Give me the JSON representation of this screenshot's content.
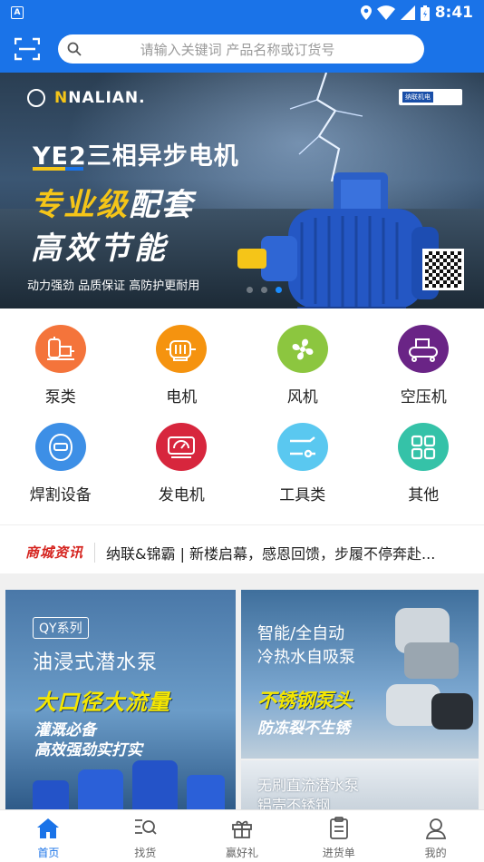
{
  "status_bar": {
    "time": "8:41",
    "app_indicator": "A"
  },
  "search": {
    "placeholder": "请输入关键词 产品名称或订货号"
  },
  "banner": {
    "brand": "NALIAN.",
    "badge": "纳联机电",
    "title": "YE2三相异步电机",
    "slogan_highlight": "专业级",
    "slogan_rest": "配套",
    "slogan2": "高效节能",
    "tagline": "动力强劲 品质保证 高防护更耐用",
    "slide_count": 3,
    "active_slide": 2
  },
  "categories": [
    {
      "label": "泵类",
      "icon": "pump-icon",
      "color": "#f4743b"
    },
    {
      "label": "电机",
      "icon": "motor-icon",
      "color": "#f5930f"
    },
    {
      "label": "风机",
      "icon": "fan-icon",
      "color": "#8cc63f"
    },
    {
      "label": "空压机",
      "icon": "air-compressor-icon",
      "color": "#6a2486"
    },
    {
      "label": "焊割设备",
      "icon": "welding-mask-icon",
      "color": "#3d8fe6"
    },
    {
      "label": "发电机",
      "icon": "generator-icon",
      "color": "#d7263d"
    },
    {
      "label": "工具类",
      "icon": "tools-icon",
      "color": "#5ac8f0"
    },
    {
      "label": "其他",
      "icon": "grid-icon",
      "color": "#35c2a8"
    }
  ],
  "news": {
    "tag": "商城资讯",
    "headline": "纳联&锦霸 | 新楼启幕，感恩回馈，步履不停奔赴..."
  },
  "promos": {
    "left": {
      "badge": "QY系列",
      "title": "油浸式潜水泵",
      "highlight": "大口径大流量",
      "sub1": "灌溉必备",
      "sub2": "高效强劲实打实"
    },
    "right_top": {
      "title1": "智能/全自动",
      "title2": "冷热水自吸泵",
      "highlight": "不锈钢泵头",
      "sub": "防冻裂不生锈"
    },
    "right_bottom": {
      "title1": "无刷直流潜水泵",
      "title2": "铝壳不锈钢"
    }
  },
  "tabbar": {
    "tabs": [
      {
        "label": "首页",
        "icon": "home-icon",
        "active": true
      },
      {
        "label": "找货",
        "icon": "find-goods-icon",
        "active": false
      },
      {
        "label": "赢好礼",
        "icon": "gift-icon",
        "active": false
      },
      {
        "label": "进货单",
        "icon": "order-list-icon",
        "active": false
      },
      {
        "label": "我的",
        "icon": "profile-icon",
        "active": false
      }
    ]
  },
  "colors": {
    "primary": "#1a73e8",
    "news_tag": "#d5241f",
    "highlight_yellow": "#f5e600"
  }
}
